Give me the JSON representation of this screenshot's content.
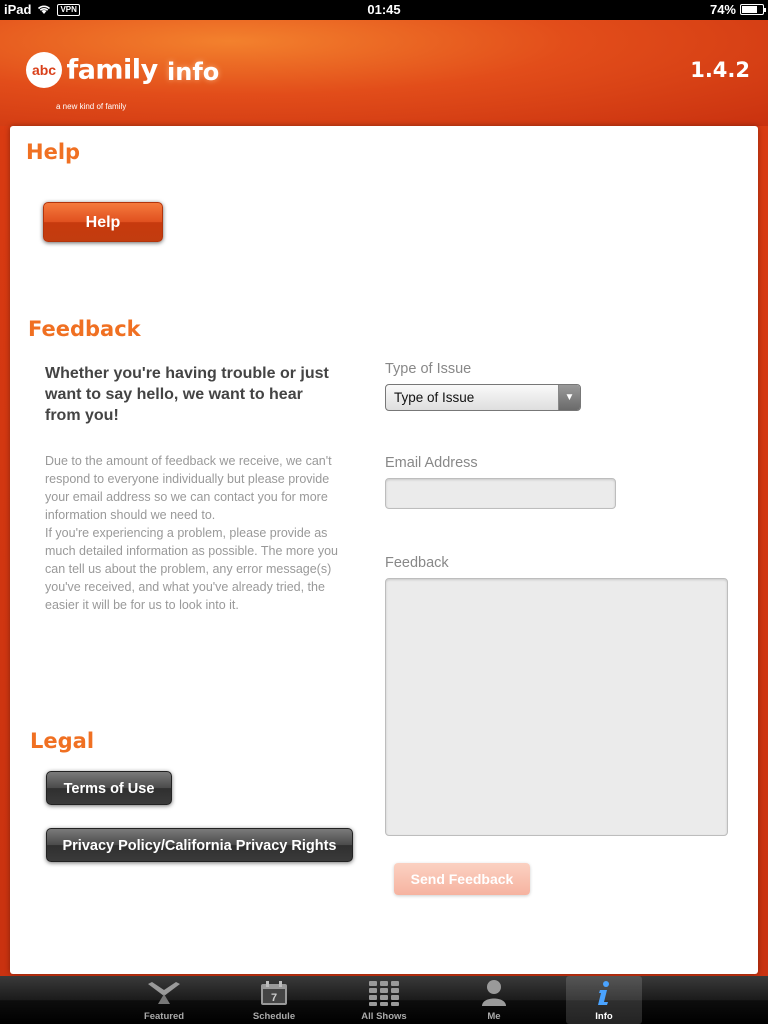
{
  "status_bar": {
    "device": "iPad",
    "vpn": "VPN",
    "time": "01:45",
    "battery": "74%",
    "battery_level": 0.74
  },
  "header": {
    "logo_abc": "abc",
    "logo_family": "family",
    "logo_tagline": "a new kind of family",
    "title": "info",
    "version": "1.4.2"
  },
  "help": {
    "title": "Help",
    "button": "Help"
  },
  "feedback": {
    "title": "Feedback",
    "lead": "Whether you're having trouble or just want to say hello, we want to hear from you!",
    "body_1": "Due to the amount of feedback we receive, we can't respond to everyone individually but please provide your email address so we can contact you for more information should we need to.",
    "body_2": "If you're experiencing a problem, please provide as much detailed information as possible. The more you can tell us about the problem, any error message(s) you've received, and what you've already tried, the easier it will be for us to look into it.",
    "type_label": "Type of Issue",
    "type_value": "Type of Issue",
    "email_label": "Email Address",
    "email_value": "",
    "feedback_label": "Feedback",
    "feedback_value": "",
    "send_button": "Send Feedback"
  },
  "legal": {
    "title": "Legal",
    "terms": "Terms of Use",
    "privacy": "Privacy Policy/California Privacy Rights"
  },
  "tabs": [
    {
      "label": "Featured",
      "icon": "featured-icon"
    },
    {
      "label": "Schedule",
      "icon": "calendar-icon",
      "day": "7"
    },
    {
      "label": "All Shows",
      "icon": "grid-icon"
    },
    {
      "label": "Me",
      "icon": "person-icon"
    },
    {
      "label": "Info",
      "icon": "info-icon",
      "active": true
    }
  ],
  "colors": {
    "brand_orange": "#e2461c",
    "section_title": "#f07022",
    "info_tab_icon": "#4aa3ff"
  }
}
